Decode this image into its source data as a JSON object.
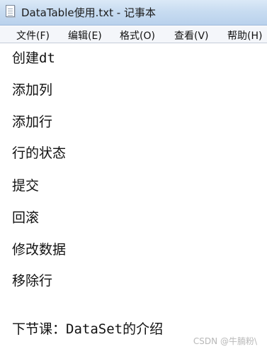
{
  "window": {
    "title": "DataTable使用.txt - 记事本",
    "file_icon": "text-document-icon"
  },
  "menu": {
    "file": "文件(F)",
    "edit": "编辑(E)",
    "format": "格式(O)",
    "view": "查看(V)",
    "help": "帮助(H)"
  },
  "editor": {
    "lines": [
      "创建dt",
      "添加列",
      "添加行",
      "行的状态",
      "提交",
      "回滚",
      "修改数据",
      "移除行",
      "下节课：DataSet的介绍"
    ]
  },
  "watermark": "CSDN @牛腩粉\\"
}
